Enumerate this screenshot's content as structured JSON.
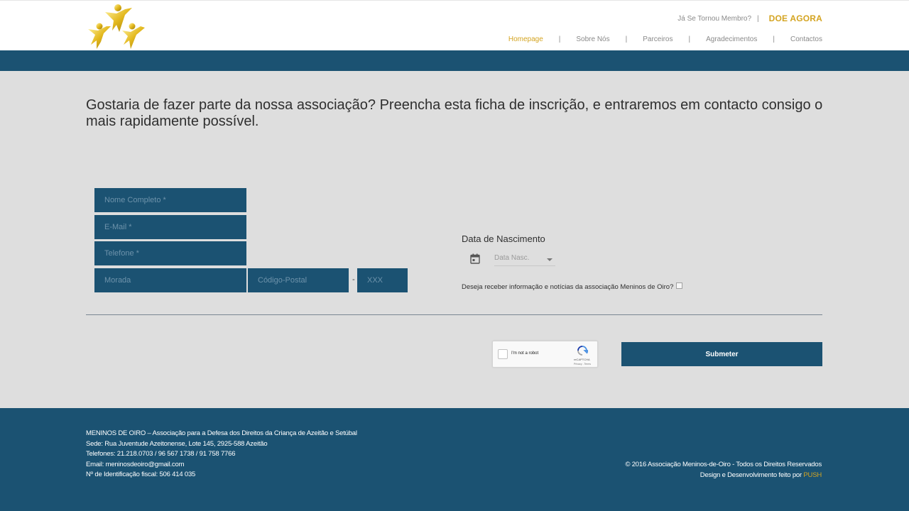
{
  "header": {
    "member_link": "Já Se Tornou Membro?",
    "separator": "|",
    "donate": "DOE AGORA",
    "nav": [
      {
        "label": "Homepage",
        "active": true
      },
      {
        "label": "Sobre Nós"
      },
      {
        "label": "Parceiros"
      },
      {
        "label": "Agradecimentos"
      },
      {
        "label": "Contactos"
      }
    ],
    "nav_separator": "|"
  },
  "intro": "Gostaria de fazer parte da nossa associação? Preencha esta ficha de inscrição, e entraremos em contacto consigo o mais rapidamente possível.",
  "form": {
    "name_placeholder": "Nome Completo *",
    "email_placeholder": "E-Mail *",
    "phone_placeholder": "Telefone *",
    "address_placeholder": "Morada",
    "postal_placeholder": "Código-Postal",
    "postal_dash": "-",
    "postal_ext_placeholder": "XXX",
    "dob_label": "Data de Nascimento",
    "dob_select": "Data Nasc.",
    "newsletter_label": "Deseja receber informação e notícias da associação Meninos de Oiro?",
    "captcha_text": "I'm not a robot",
    "captcha_brand": "reCAPTCHA",
    "captcha_terms": "Privacy - Terms",
    "submit": "Submeter"
  },
  "footer": {
    "lines": [
      "MENINOS DE OIRO – Associação para a Defesa dos Direitos da Criança de Azeitão e Setúbal",
      "Sede: Rua Juventude Azeitonense, Lote 145, 2925-588 Azeitão",
      "Telefones: 21.218.0703 / 96 567 1738 / 91 758 7766",
      "Email: meninosdeoiro@gmail.com",
      "Nº de Identificação fiscal: 506 414 035"
    ],
    "copyright": "© 2016 Associação Meninos-de-Oiro - Todos os Direitos Reservados",
    "credit_prefix": "Design e Desenvolvimento feito por ",
    "credit_brand": "PUSH"
  },
  "colors": {
    "brand_blue": "#1b5272",
    "accent_gold": "#d4a421",
    "background": "#dedede"
  },
  "icons": [
    "logo-stars-icon",
    "calendar-icon",
    "recaptcha-icon",
    "dropdown-caret-icon"
  ]
}
